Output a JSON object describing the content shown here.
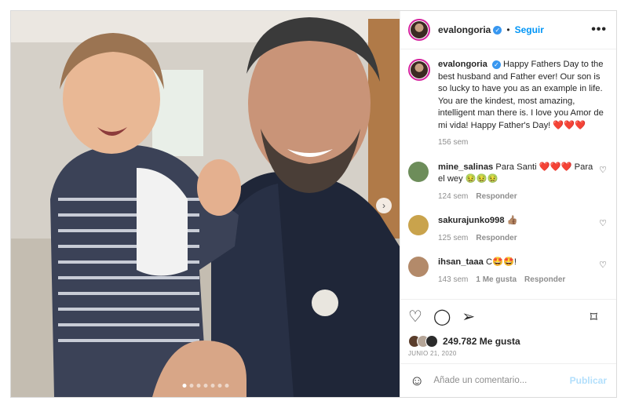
{
  "post": {
    "username": "evalongoria",
    "follow_label": "Seguir",
    "separator": "•",
    "verified_mark": "✓",
    "more_icon": "•••",
    "caption_text": "Happy Fathers Day to the best husband and Father ever! Our son is so lucky to have you as an example in life. You are the kindest, most amazing, intelligent man there is. I love you Amor de mi vida! Happy Father's Day! ❤️❤️❤️",
    "caption_age": "156 sem",
    "slide_count": 7,
    "active_slide": 1
  },
  "comments": [
    {
      "user": "mine_salinas",
      "text": "Para Santi ❤️❤️❤️ Para el wey 🤢🤢🤢",
      "age": "124 sem",
      "likes": "",
      "reply": "Responder",
      "avatar_color": "#6d8d5a"
    },
    {
      "user": "sakurajunko998",
      "text": "👍🏽",
      "age": "125 sem",
      "likes": "",
      "reply": "Responder",
      "avatar_color": "#c9a34c"
    },
    {
      "user": "ihsan_taaa",
      "text": "C🤩🤩!",
      "age": "143 sem",
      "likes": "1 Me gusta",
      "reply": "Responder",
      "avatar_color": "#b38a6a"
    }
  ],
  "actions": {
    "like_icon": "♡",
    "comment_icon": "◯",
    "share_icon": "➢",
    "save_icon": "⌑"
  },
  "likes": {
    "count_label": "249.782 Me gusta",
    "avatar_colors": [
      "#5a3d2b",
      "#b5a597",
      "#2b2b2b"
    ]
  },
  "date": "JUNIO 21, 2020",
  "add_comment": {
    "emoji_icon": "☺",
    "placeholder": "Añade un comentario...",
    "publish_label": "Publicar"
  },
  "colors": {
    "accent": "#0095f6",
    "verified": "#3897f0",
    "muted": "#8e8e8e",
    "publish_disabled": "#b2dffc"
  }
}
